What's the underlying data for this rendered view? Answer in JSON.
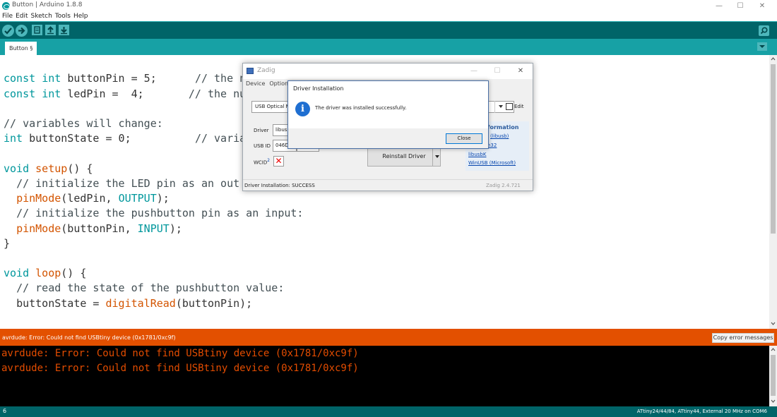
{
  "window": {
    "title": "Button | Arduino 1.8.8",
    "minimize": "—",
    "maximize": "☐",
    "close": "✕"
  },
  "menu": [
    "File",
    "Edit",
    "Sketch",
    "Tools",
    "Help"
  ],
  "toolbar": {
    "verify_icon": "checkmark-icon",
    "upload_icon": "arrow-right-icon",
    "new_icon": "new-file-icon",
    "open_icon": "open-icon",
    "save_icon": "save-icon",
    "serial_icon": "search-icon"
  },
  "tabs": [
    "Button §"
  ],
  "code": {
    "l1": "buttonPin = 5;",
    "l2": "ledPin =  4;",
    "l3": "// variables will change:",
    "l4": "buttonState = 0;",
    "l5_fn": "setup",
    "l6": "// initialize the LED pin as an out",
    "l7_fn": "pinMode",
    "l7_args": "(ledPin, ",
    "l7_const": "OUTPUT",
    "l8": "// initialize the pushbutton pin as an input:",
    "l9_fn": "pinMode",
    "l9_args": "(buttonPin, ",
    "l9_const": "INPUT",
    "l10": "}",
    "l11_fn": "loop",
    "l12": "// read the state of the pushbutton value:",
    "l13_pre": "buttonState = ",
    "l13_fn": "digitalRead",
    "l13_args": "(buttonPin);",
    "kw_const": "const",
    "kw_int": "int",
    "kw_void": "void",
    "comment1": "// the n",
    "comment2": "// the nu",
    "comment3": "// varia",
    "parens_brace": "() {",
    "close_paren": ");"
  },
  "error_bar": {
    "message": "avrdude: Error: Could not find USBtiny device (0x1781/0xc9f)",
    "copy_button": "Copy error messages"
  },
  "console": [
    "avrdude: Error: Could not find USBtiny device (0x1781/0xc9f)",
    "avrdude: Error: Could not find USBtiny device (0x1781/0xc9f)"
  ],
  "status": {
    "line": "6",
    "board": "ATtiny24/44/84, ATtiny44, External 20 MHz on COM6"
  },
  "zadig": {
    "title": "Zadig",
    "menu": [
      "Device",
      "Options"
    ],
    "device": "USB Optical M",
    "edit_label": "Edit",
    "driver_label": "Driver",
    "driver_value": "libusb",
    "usbid_label": "USB ID",
    "usbid_value": "046D",
    "wcid_label": "WCID",
    "wcid_sup": "2",
    "wcid_mark": "✕",
    "reinstall_button": "Reinstall Driver",
    "info_title": "formation",
    "links": [
      "(libusb)",
      "n32",
      "libusbK",
      "WinUSB (Microsoft)"
    ],
    "status_text": "Driver Installation: SUCCESS",
    "version": "Zadig 2.4.721"
  },
  "dialog": {
    "title": "Driver Installation",
    "message": "The driver was installed successfully.",
    "icon_glyph": "i",
    "close_button": "Close"
  }
}
